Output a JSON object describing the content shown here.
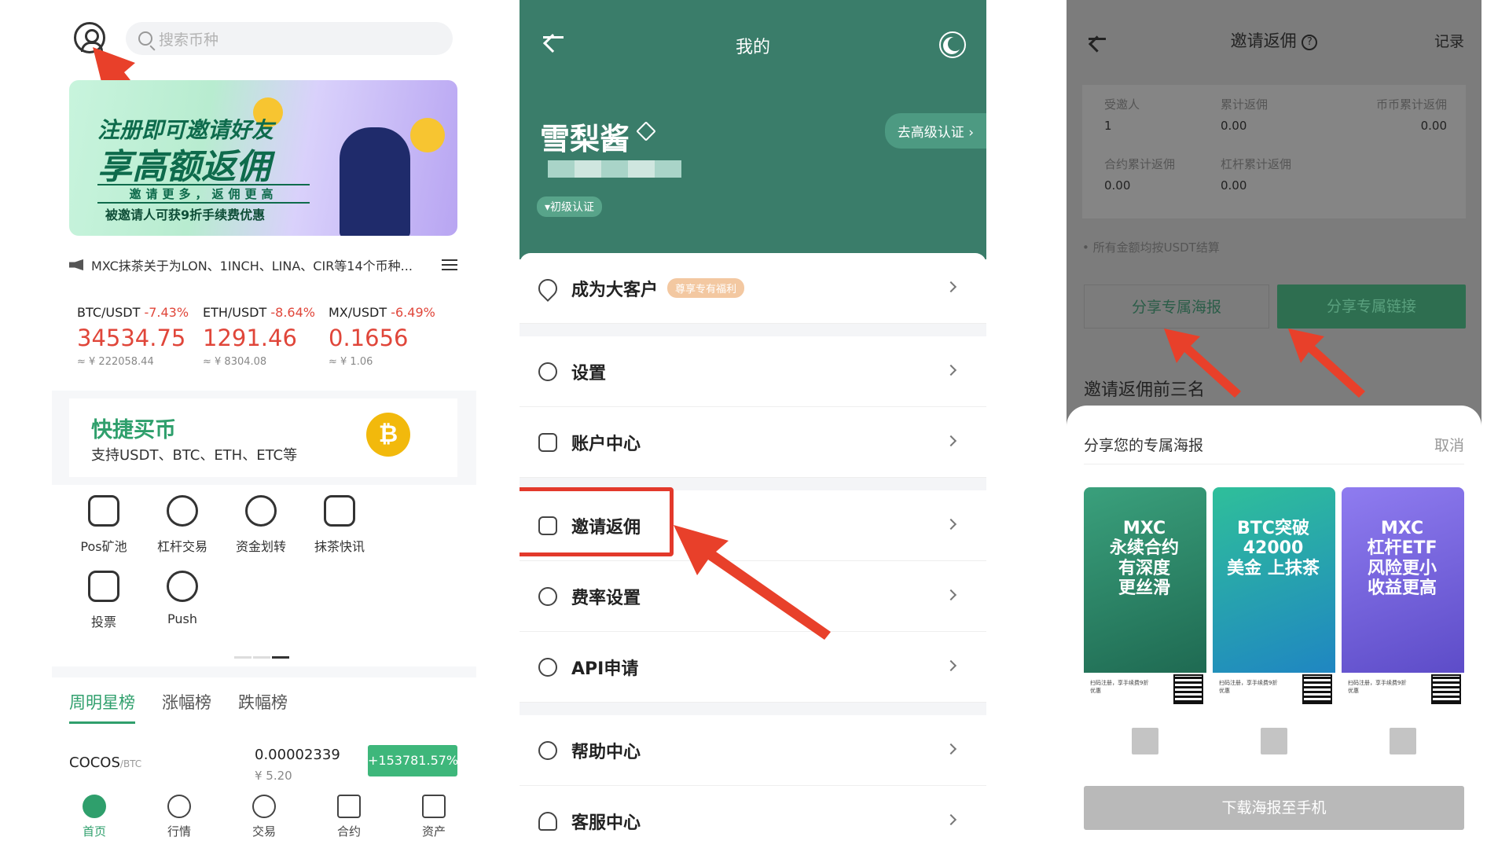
{
  "panel1": {
    "search_placeholder": "搜索币种",
    "banner": {
      "line1": "注册即可邀请好友",
      "line2": "享高额返佣",
      "line3": "邀请更多，返佣更高",
      "line4": "被邀请人可获9折手续费优惠"
    },
    "news": "MXC抹茶关于为LON、1INCH、LINA、CIR等14个币种...",
    "tickers": [
      {
        "pair": "BTC/USDT",
        "change": "-7.43%",
        "price": "34534.75",
        "cny": "≈ ¥ 222058.44"
      },
      {
        "pair": "ETH/USDT",
        "change": "-8.64%",
        "price": "1291.46",
        "cny": "≈ ¥ 8304.08"
      },
      {
        "pair": "MX/USDT",
        "change": "-6.49%",
        "price": "0.1656",
        "cny": "≈ ¥ 1.06"
      }
    ],
    "quickbuy": {
      "title": "快捷买币",
      "subtitle": "支持USDT、BTC、ETH、ETC等"
    },
    "grid": [
      {
        "label": "Pos矿池",
        "icon": "piggy-bank-icon"
      },
      {
        "label": "杠杆交易",
        "icon": "gauge-icon"
      },
      {
        "label": "资金划转",
        "icon": "transfer-icon"
      },
      {
        "label": "抹茶快讯",
        "icon": "news-icon"
      },
      {
        "label": "投票",
        "icon": "vote-icon"
      },
      {
        "label": "Push",
        "icon": "push-icon"
      }
    ],
    "tabs": [
      "周明星榜",
      "涨幅榜",
      "跌幅榜"
    ],
    "row": {
      "name": "COCOS",
      "quote": "/BTC",
      "price": "0.00002339",
      "cny": "¥ 5.20",
      "change": "+153781.57%"
    },
    "nav": [
      "首页",
      "行情",
      "交易",
      "合约",
      "资产"
    ]
  },
  "panel2": {
    "title": "我的",
    "username": "雪梨酱",
    "badge": "初级认证",
    "kyc_button": "去高级认证 ›",
    "menu": [
      {
        "label": "成为大客户",
        "icon": "diamond-icon",
        "tag": "尊享专有福利"
      },
      {
        "label": "设置",
        "icon": "gear-icon"
      },
      {
        "label": "账户中心",
        "icon": "lock-icon"
      },
      {
        "label": "邀请返佣",
        "icon": "wallet-icon"
      },
      {
        "label": "费率设置",
        "icon": "rate-icon"
      },
      {
        "label": "API申请",
        "icon": "link-icon"
      },
      {
        "label": "帮助中心",
        "icon": "heart-icon"
      },
      {
        "label": "客服中心",
        "icon": "headset-icon"
      }
    ]
  },
  "panel3": {
    "title": "邀请返佣",
    "records": "记录",
    "stats": [
      {
        "label": "受邀人",
        "value": "1"
      },
      {
        "label": "累计返佣",
        "value": "0.00"
      },
      {
        "label": "币币累计返佣",
        "value": "0.00"
      },
      {
        "label": "合约累计返佣",
        "value": "0.00"
      },
      {
        "label": "杠杆累计返佣",
        "value": "0.00"
      }
    ],
    "note": "• 所有金额均按USDT结算",
    "share_poster": "分享专属海报",
    "share_link": "分享专属链接",
    "top3": "邀请返佣前三名",
    "sheet": {
      "title": "分享您的专属海报",
      "cancel": "取消",
      "posters": [
        {
          "text": "MXC\n永续合约\n有深度\n更丝滑",
          "color": "#2f9171"
        },
        {
          "text": "BTC突破\n42000\n美金 上抹茶",
          "color": "#2fa7c7"
        },
        {
          "text": "MXC\n杠杆ETF\n风险更小\n收益更高",
          "color": "#7f6be0"
        }
      ],
      "poster_footer": "扫码注册，享手续费9折优惠",
      "download": "下载海报至手机"
    }
  }
}
